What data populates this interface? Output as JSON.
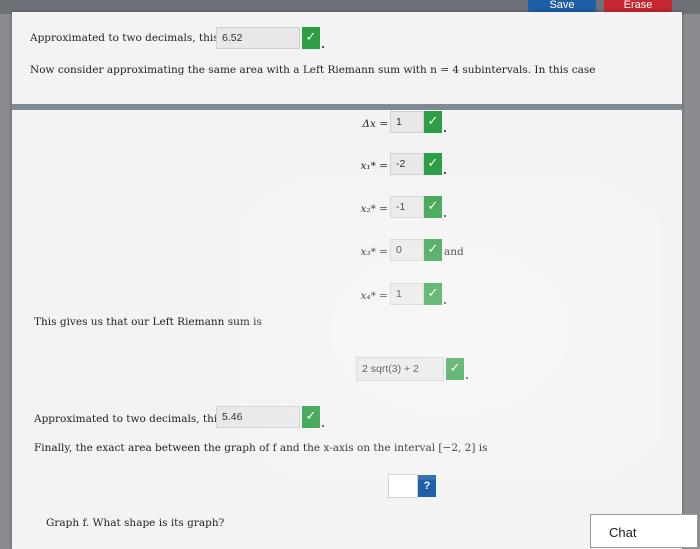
{
  "toolbar": {
    "save_label": "Save",
    "erase_label": "Erase"
  },
  "section1": {
    "approx_prompt": "Approximated to two decimals, this is",
    "approx_value": "6.52"
  },
  "section2": {
    "intro": "Now consider approximating the same area with a Left Riemann sum with n = 4 subintervals. In this case",
    "delta_label": "Δx =",
    "delta_value": "1",
    "points": [
      {
        "label": "x₁* =",
        "value": "-2"
      },
      {
        "label": "x₂* =",
        "value": "-1"
      },
      {
        "label": "x₃* =",
        "value": "0"
      },
      {
        "label": "x₄* =",
        "value": "1"
      }
    ],
    "and_word": "and",
    "sum_prompt": "This gives us that our Left Riemann sum is",
    "sum_value": "2 sqrt(3) + 2",
    "approx_prompt": "Approximated to two decimals, this is",
    "approx_value": "5.46",
    "exact_prompt": "Finally, the exact area between the graph of f and the x-axis on the interval [−2, 2] is",
    "exact_value": "",
    "help_label": "?"
  },
  "section3": {
    "graph_prompt": "Graph f. What shape is its graph?"
  },
  "chat": {
    "label": "Chat"
  },
  "icons": {
    "check": "check-icon",
    "help": "help-icon"
  },
  "colors": {
    "check_green": "#2e9e44",
    "help_blue": "#1f5fa8",
    "erase_red": "#c5262f"
  }
}
